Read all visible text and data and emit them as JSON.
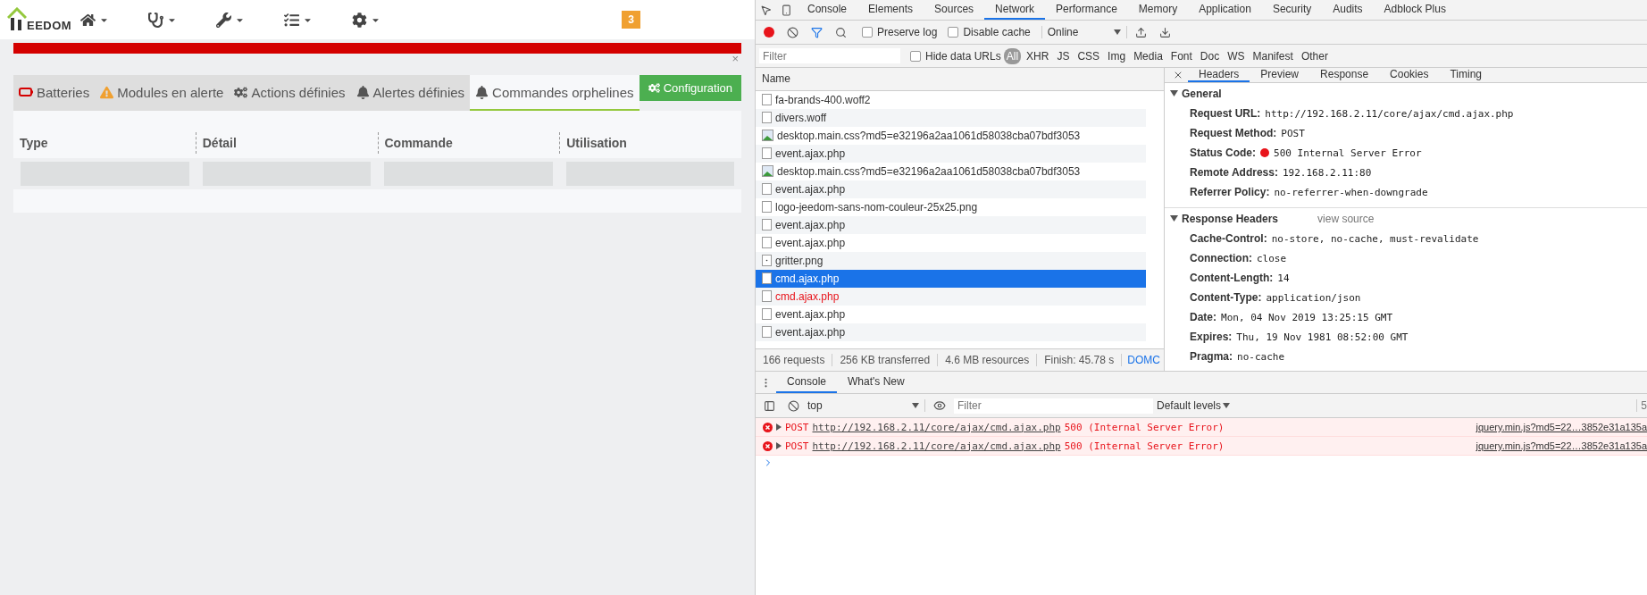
{
  "app": {
    "logo": "EEDOM",
    "nav_menus": [
      {
        "kind": "home"
      },
      {
        "kind": "health"
      },
      {
        "kind": "tools"
      },
      {
        "kind": "tasks"
      },
      {
        "kind": "settings"
      }
    ],
    "badge": "3",
    "alert": {
      "close": "×"
    },
    "tabs": [
      {
        "label": "Batteries",
        "kind": "battery",
        "selected": false
      },
      {
        "label": "Modules en alerte",
        "kind": "warning",
        "selected": false
      },
      {
        "label": "Actions définies",
        "kind": "cogs",
        "selected": false
      },
      {
        "label": "Alertes définies",
        "kind": "bell",
        "selected": false
      },
      {
        "label": "Commandes orphelines",
        "kind": "bell",
        "selected": true
      }
    ],
    "config_button": "Configuration",
    "table": {
      "columns": [
        "Type",
        "Détail",
        "Commande",
        "Utilisation"
      ]
    }
  },
  "devtools": {
    "tabs": [
      {
        "label": "Console",
        "selected": false
      },
      {
        "label": "Elements",
        "selected": false
      },
      {
        "label": "Sources",
        "selected": false
      },
      {
        "label": "Network",
        "selected": true
      },
      {
        "label": "Performance",
        "selected": false
      },
      {
        "label": "Memory",
        "selected": false
      },
      {
        "label": "Application",
        "selected": false
      },
      {
        "label": "Security",
        "selected": false
      },
      {
        "label": "Audits",
        "selected": false
      },
      {
        "label": "Adblock Plus",
        "selected": false
      }
    ],
    "toolbar": {
      "recording": true,
      "preserve_log": {
        "label": "Preserve log",
        "checked": false
      },
      "disable_cache": {
        "label": "Disable cache",
        "checked": false
      },
      "throttling": "Online"
    },
    "filter": {
      "placeholder": "Filter",
      "hide_data_urls": {
        "label": "Hide data URLs",
        "checked": false
      },
      "types": [
        {
          "label": "All",
          "selected": true
        },
        {
          "label": "XHR",
          "selected": false
        },
        {
          "label": "JS",
          "selected": false
        },
        {
          "label": "CSS",
          "selected": false
        },
        {
          "label": "Img",
          "selected": false
        },
        {
          "label": "Media",
          "selected": false
        },
        {
          "label": "Font",
          "selected": false
        },
        {
          "label": "Doc",
          "selected": false
        },
        {
          "label": "WS",
          "selected": false
        },
        {
          "label": "Manifest",
          "selected": false
        },
        {
          "label": "Other",
          "selected": false
        }
      ]
    },
    "requests_header": "Name",
    "requests": [
      {
        "name": "fa-brands-400.woff2",
        "kind": "file",
        "selected": false,
        "error": false
      },
      {
        "name": "divers.woff",
        "kind": "file",
        "selected": false,
        "error": false
      },
      {
        "name": "desktop.main.css?md5=e32196a2aa1061d58038cba07bdf3053",
        "kind": "image",
        "selected": false,
        "error": false
      },
      {
        "name": "event.ajax.php",
        "kind": "file",
        "selected": false,
        "error": false
      },
      {
        "name": "desktop.main.css?md5=e32196a2aa1061d58038cba07bdf3053",
        "kind": "image",
        "selected": false,
        "error": false
      },
      {
        "name": "event.ajax.php",
        "kind": "file",
        "selected": false,
        "error": false
      },
      {
        "name": "logo-jeedom-sans-nom-couleur-25x25.png",
        "kind": "file",
        "selected": false,
        "error": false
      },
      {
        "name": "event.ajax.php",
        "kind": "file",
        "selected": false,
        "error": false
      },
      {
        "name": "event.ajax.php",
        "kind": "file",
        "selected": false,
        "error": false
      },
      {
        "name": "gritter.png",
        "kind": "dot",
        "selected": false,
        "error": false
      },
      {
        "name": "cmd.ajax.php",
        "kind": "file",
        "selected": true,
        "error": false
      },
      {
        "name": "cmd.ajax.php",
        "kind": "file",
        "selected": false,
        "error": true
      },
      {
        "name": "event.ajax.php",
        "kind": "file",
        "selected": false,
        "error": false
      },
      {
        "name": "event.ajax.php",
        "kind": "file",
        "selected": false,
        "error": false
      }
    ],
    "summary": [
      "166 requests",
      "256 KB transferred",
      "4.6 MB resources",
      "Finish: 45.78 s"
    ],
    "summary_link": "DOMC",
    "detail_tabs": [
      {
        "label": "Headers",
        "selected": true
      },
      {
        "label": "Preview",
        "selected": false
      },
      {
        "label": "Response",
        "selected": false
      },
      {
        "label": "Cookies",
        "selected": false
      },
      {
        "label": "Timing",
        "selected": false
      }
    ],
    "sections": [
      {
        "title": "General",
        "expanded": true,
        "rows": [
          {
            "name": "Request URL:",
            "value": "http://192.168.2.11/core/ajax/cmd.ajax.php"
          },
          {
            "name": "Request Method:",
            "value": "POST"
          },
          {
            "name": "Status Code:",
            "value": "500 Internal Server Error",
            "color": "#e8141b"
          },
          {
            "name": "Remote Address:",
            "value": "192.168.2.11:80"
          },
          {
            "name": "Referrer Policy:",
            "value": "no-referrer-when-downgrade"
          }
        ]
      },
      {
        "title": "Response Headers",
        "expanded": true,
        "link": "view source",
        "rows": [
          {
            "name": "Cache-Control:",
            "value": "no-store, no-cache, must-revalidate"
          },
          {
            "name": "Connection:",
            "value": "close"
          },
          {
            "name": "Content-Length:",
            "value": "14"
          },
          {
            "name": "Content-Type:",
            "value": "application/json"
          },
          {
            "name": "Date:",
            "value": "Mon, 04 Nov 2019 13:25:15 GMT"
          },
          {
            "name": "Expires:",
            "value": "Thu, 19 Nov 1981 08:52:00 GMT"
          },
          {
            "name": "Pragma:",
            "value": "no-cache"
          }
        ]
      }
    ],
    "drawer_tabs": [
      {
        "label": "Console",
        "selected": true
      },
      {
        "label": "What's New",
        "selected": false
      }
    ],
    "console": {
      "context": "top",
      "filter_placeholder": "Filter",
      "levels": "Default levels",
      "count": "5",
      "messages": [
        {
          "method": "POST",
          "url": "http://192.168.2.11/core/ajax/cmd.ajax.php",
          "status": "500 (Internal Server Error)",
          "source": "jquery.min.js?md5=22…3852e31a135a"
        },
        {
          "method": "POST",
          "url": "http://192.168.2.11/core/ajax/cmd.ajax.php",
          "status": "500 (Internal Server Error)",
          "source": "jquery.min.js?md5=22…3852e31a135a"
        }
      ]
    }
  }
}
